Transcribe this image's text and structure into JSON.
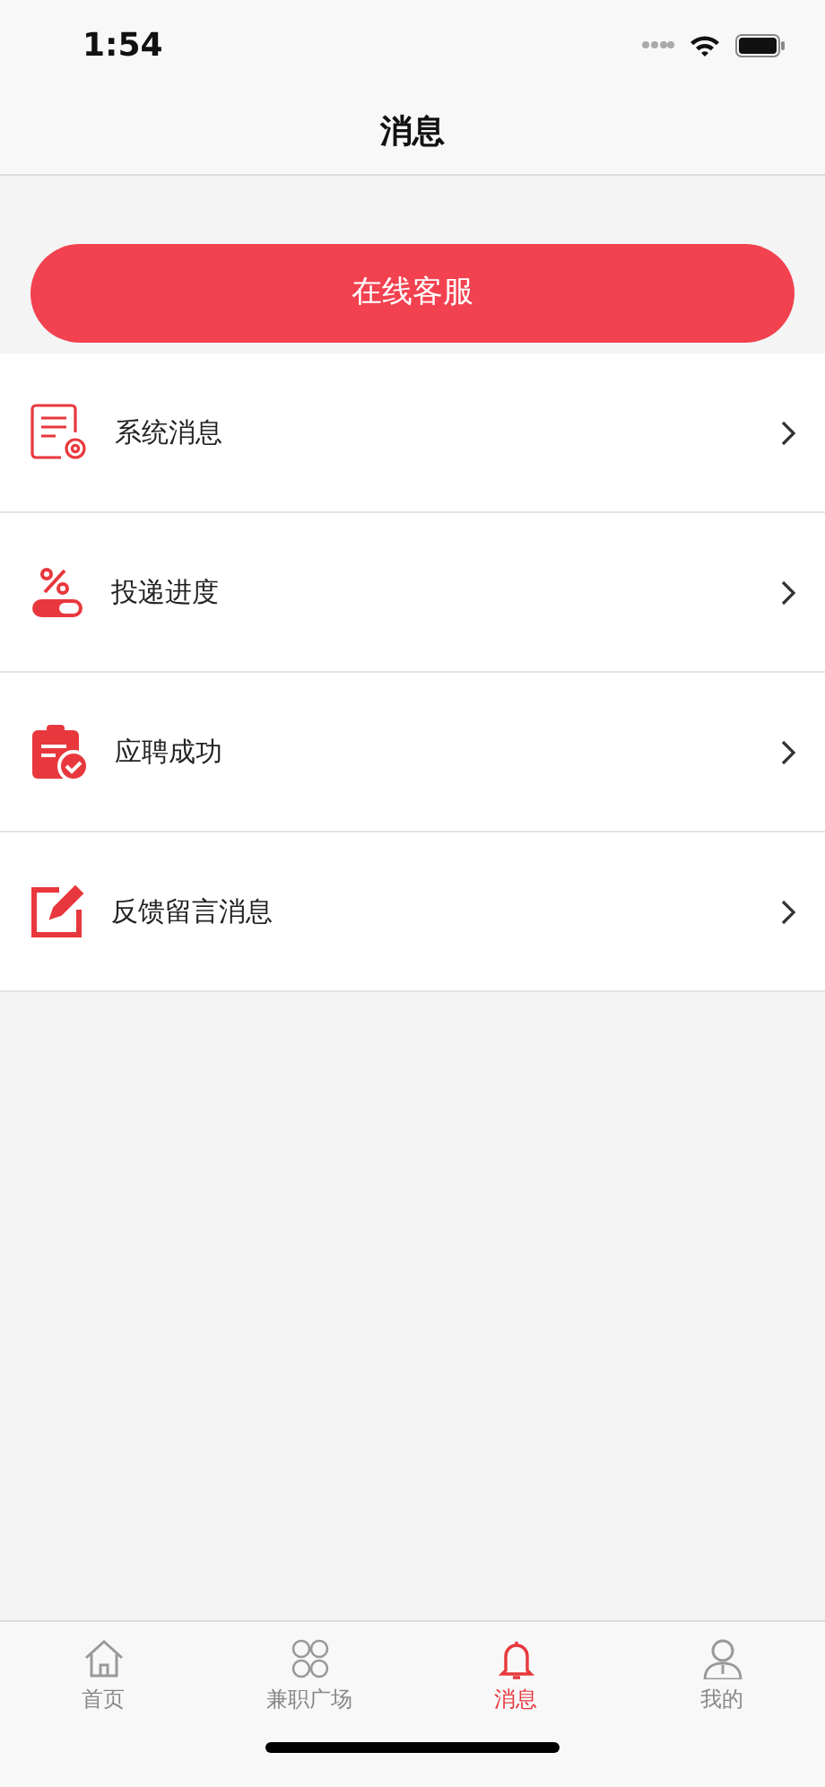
{
  "status_bar": {
    "time": "1:54"
  },
  "header": {
    "title": "消息"
  },
  "service_button": {
    "label": "在线客服"
  },
  "messages": [
    {
      "kind": "system",
      "label": "系统消息"
    },
    {
      "kind": "delivery",
      "label": "投递进度"
    },
    {
      "kind": "hired",
      "label": "应聘成功"
    },
    {
      "kind": "feedback",
      "label": "反馈留言消息"
    }
  ],
  "tab_bar": [
    {
      "kind": "home",
      "label": "首页",
      "selected": false
    },
    {
      "kind": "grid",
      "label": "兼职广场",
      "selected": false
    },
    {
      "kind": "bell",
      "label": "消息",
      "selected": true
    },
    {
      "kind": "user",
      "label": "我的",
      "selected": false
    }
  ]
}
